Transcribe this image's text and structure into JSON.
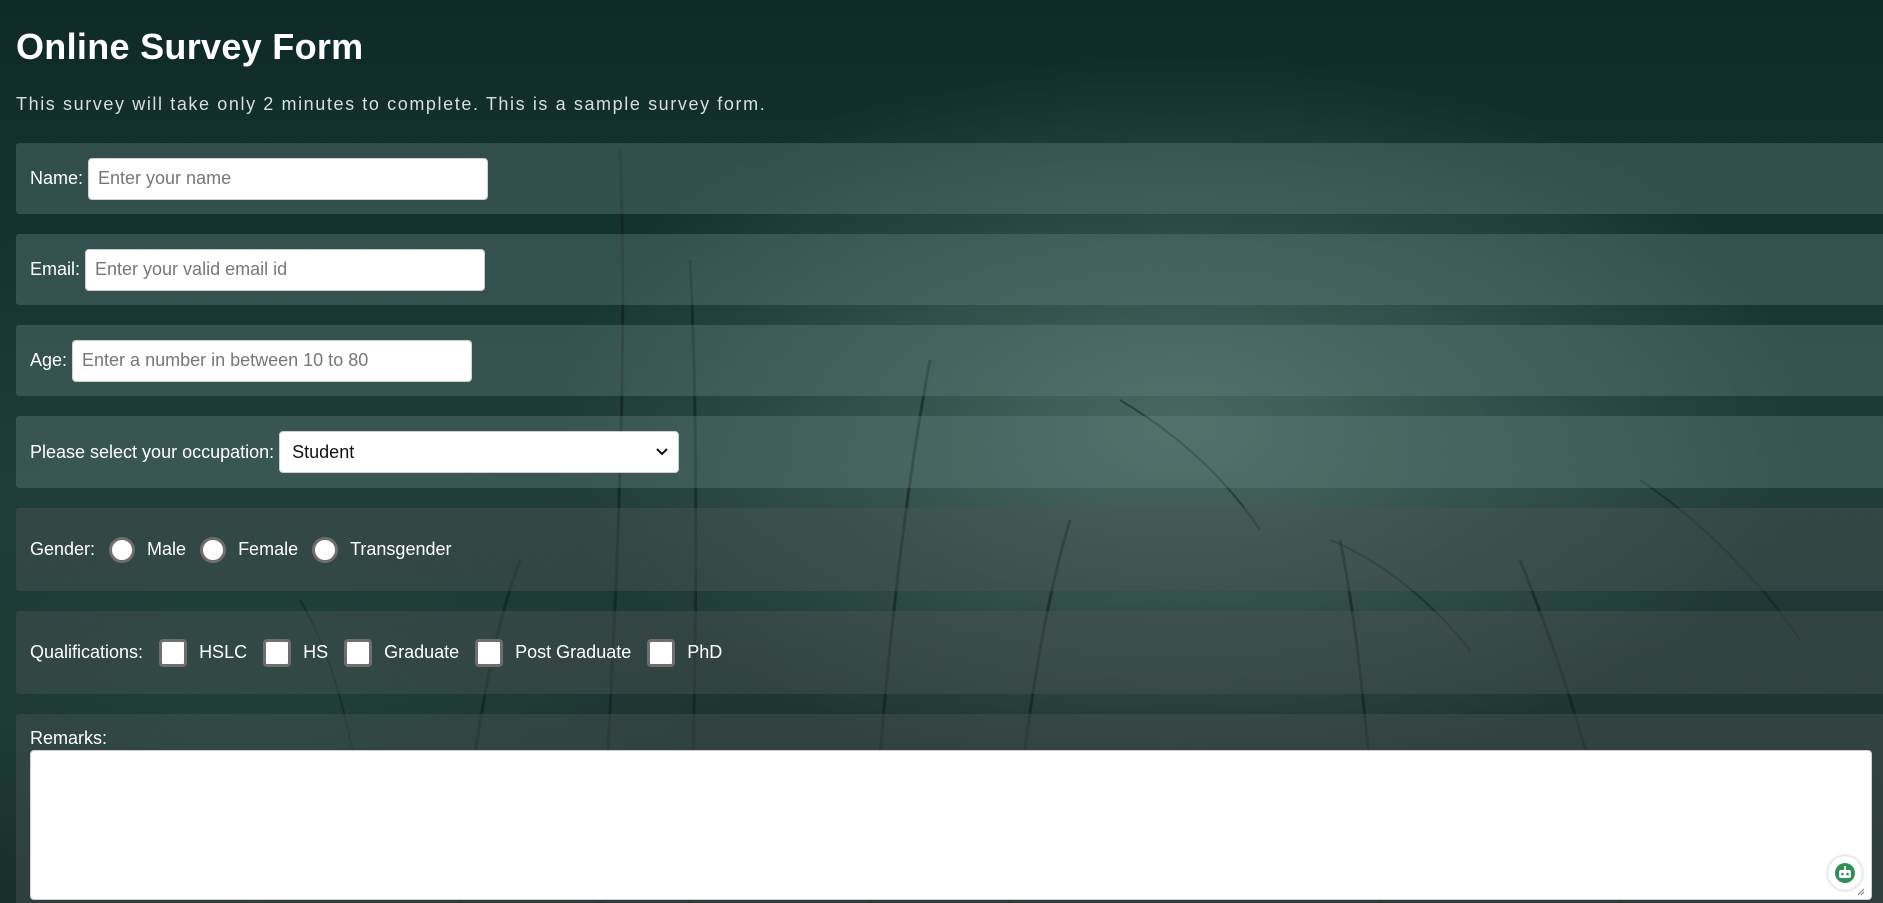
{
  "header": {
    "title": "Online Survey Form",
    "subtitle": "This survey will take only 2 minutes to complete. This is a sample survey form."
  },
  "form": {
    "name": {
      "label": "Name:",
      "placeholder": "Enter your name",
      "value": ""
    },
    "email": {
      "label": "Email:",
      "placeholder": "Enter your valid email id",
      "value": ""
    },
    "age": {
      "label": "Age:",
      "placeholder": "Enter a number in between 10 to 80",
      "value": ""
    },
    "occupation": {
      "label": "Please select your occupation:",
      "selected": "Student"
    },
    "gender": {
      "label": "Gender:",
      "options": [
        "Male",
        "Female",
        "Transgender"
      ]
    },
    "qualifications": {
      "label": "Qualifications:",
      "options": [
        "HSLC",
        "HS",
        "Graduate",
        "Post Graduate",
        "PhD"
      ]
    },
    "remarks": {
      "label": "Remarks:",
      "value": ""
    }
  },
  "icons": {
    "select": "chevron-down-icon",
    "assistant": "robot-assistant-icon",
    "resize": "resize-grip-icon"
  },
  "colors": {
    "background": "#14332f",
    "panel": "#4a6863",
    "panel_dark": "#3f4a48",
    "input_bg": "#ffffff",
    "control_border": "#6e6e6e"
  }
}
